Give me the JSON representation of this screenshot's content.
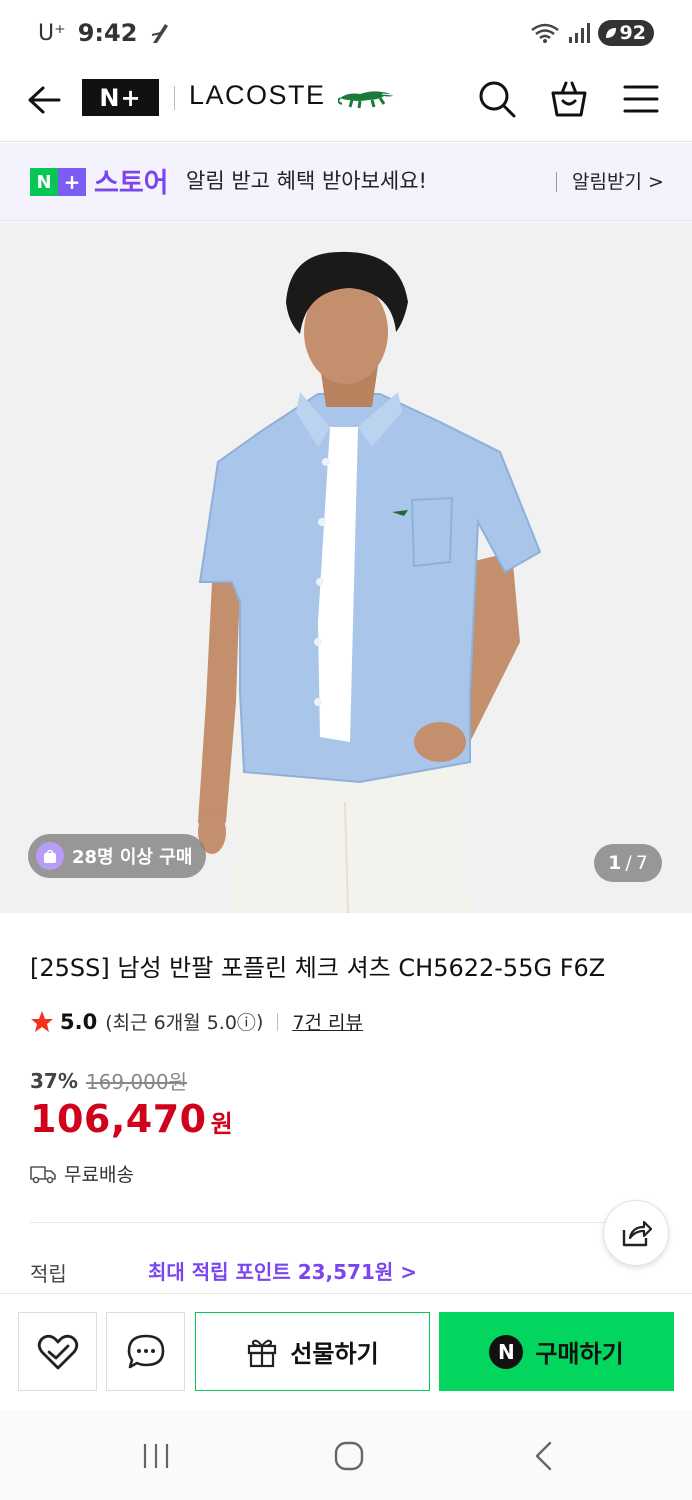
{
  "status_bar": {
    "carrier": "U⁺",
    "time": "9:42",
    "battery": "92"
  },
  "header": {
    "nplus_logo": "N+",
    "brand_name": "LACOSTE",
    "icons": [
      "back-arrow-icon",
      "search-icon",
      "shopping-bag-icon",
      "menu-icon"
    ]
  },
  "promo": {
    "badge_n": "N",
    "badge_plus": "+",
    "store_label": "스토어",
    "message": "알림 받고 혜택 받아보세요!",
    "link_label": "알림받기 >"
  },
  "gallery": {
    "buyers_badge": "28명 이상 구매",
    "current_index": "1",
    "separator": "/",
    "total": "7"
  },
  "product": {
    "title": "[25SS] 남성 반팔 포플린 체크 셔츠 CH5622-55G F6Z",
    "rating_score": "5.0",
    "rating_recent_prefix": "(최근 6개월 5.0",
    "rating_info_icon": "ⓘ",
    "rating_recent_suffix": ")",
    "review_link": "7건 리뷰",
    "discount_percent": "37%",
    "original_price": "169,000원",
    "sale_price": "106,470",
    "currency": "원",
    "shipping": "무료배송",
    "points_label": "적립",
    "points_value": "최대 적립 포인트 23,571원 >"
  },
  "actions": {
    "gift_label": "선물하기",
    "buy_label": "구매하기",
    "buy_badge": "N"
  },
  "colors": {
    "naver_green": "#03d65f",
    "nplus_purple": "#7b45f0",
    "sale_red": "#d0021b"
  }
}
